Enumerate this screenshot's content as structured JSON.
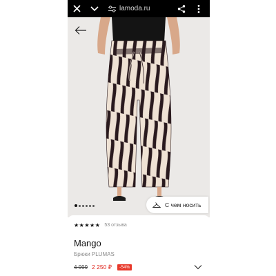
{
  "browser": {
    "url": "lamoda.ru",
    "icons": [
      "close-icon",
      "chevron-down-icon",
      "tune-icon",
      "share-icon",
      "more-vertical-icon"
    ]
  },
  "product": {
    "gallery": {
      "current_image": 1,
      "image_count": 6
    },
    "outfit_button_label": "С чем носить",
    "rating_stars": "★★★★★",
    "rating_value": 5,
    "reviews_label": "53 отзыва",
    "brand": "Mango",
    "name": "Брюки PLUMAS",
    "old_price": "4 999",
    "new_price": "2 250 ₽",
    "discount_label": "-54%"
  },
  "colors": {
    "browser_bar": "#000000",
    "price_accent": "#e0281f",
    "discount_badge": "#e8392b"
  }
}
